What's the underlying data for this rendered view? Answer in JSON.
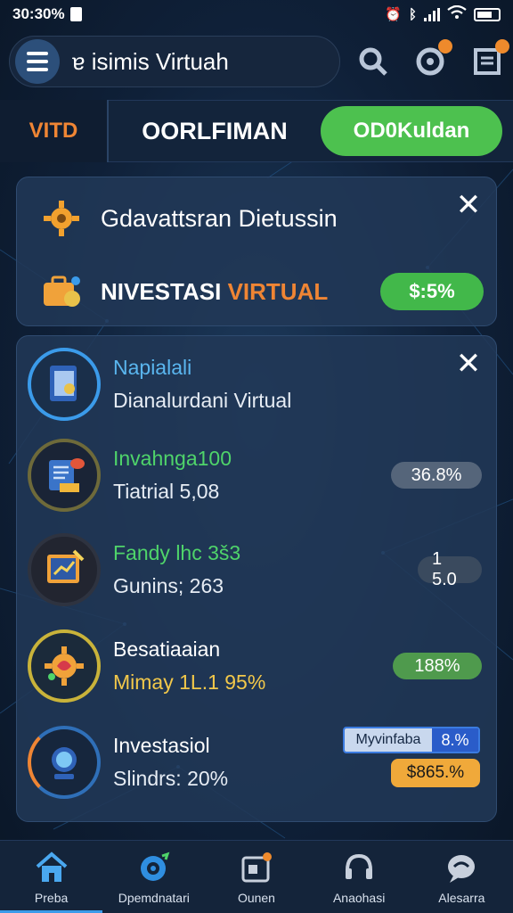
{
  "status_bar": {
    "time": "30:30%",
    "right_icons": [
      "alarm-icon",
      "bluetooth-icon",
      "signal-icon",
      "wifi-icon",
      "battery-icon"
    ]
  },
  "header": {
    "search_text": "isimis Virtuah",
    "search_prefix": "ɐ"
  },
  "tabs": {
    "left": "VITD",
    "middle": "OORLFIMAN",
    "cta": "OD0Kuldan"
  },
  "notice_card": {
    "title": "Gdavattsran Dietussin",
    "invest_title_white": "NIVESTASI",
    "invest_title_orange": "VIRTUAL",
    "invest_value": "$:5%"
  },
  "list": {
    "items": [
      {
        "title": "Napialali",
        "subtitle": "Dianalurdani Virtual",
        "title_color": "#5ab6ef",
        "chip": ""
      },
      {
        "title": "Invahnga100",
        "subtitle": "Tiatrial 5,08",
        "title_color": "#4fd46a",
        "chip": "36.8%",
        "chip_color": "#55657a"
      },
      {
        "title": "Fandy lhc 3š3",
        "subtitle": "Gunins; 263",
        "title_color": "#4fd46a",
        "chip": "1 5.0",
        "chip_color": "#3a4a5e"
      },
      {
        "title": "Besatiaaian",
        "subtitle": "Mimay 1L.1 95%",
        "title_color": "#ffffff",
        "subtitle_color": "#f2c84a",
        "chip": "188%",
        "chip_color": "#4f9a4d"
      },
      {
        "title": "Investasiol",
        "subtitle": "Slindrs: 20%",
        "title_color": "#ffffff",
        "chip_tag": "Myvinfaba",
        "chip_tag_value": "8.%",
        "chip_amount": "$865.%"
      }
    ]
  },
  "bottom_nav": [
    {
      "label": "Preba",
      "icon": "home-icon",
      "active": true
    },
    {
      "label": "Dpemdnatari",
      "icon": "target-icon",
      "active": false
    },
    {
      "label": "Ounen",
      "icon": "wallet-icon",
      "active": false
    },
    {
      "label": "Anaohasi",
      "icon": "headset-icon",
      "active": false
    },
    {
      "label": "Alesarra",
      "icon": "chat-icon",
      "active": false
    }
  ],
  "colors": {
    "accent_orange": "#ef8534",
    "accent_green": "#4dc14f",
    "accent_blue": "#3b9bea"
  }
}
